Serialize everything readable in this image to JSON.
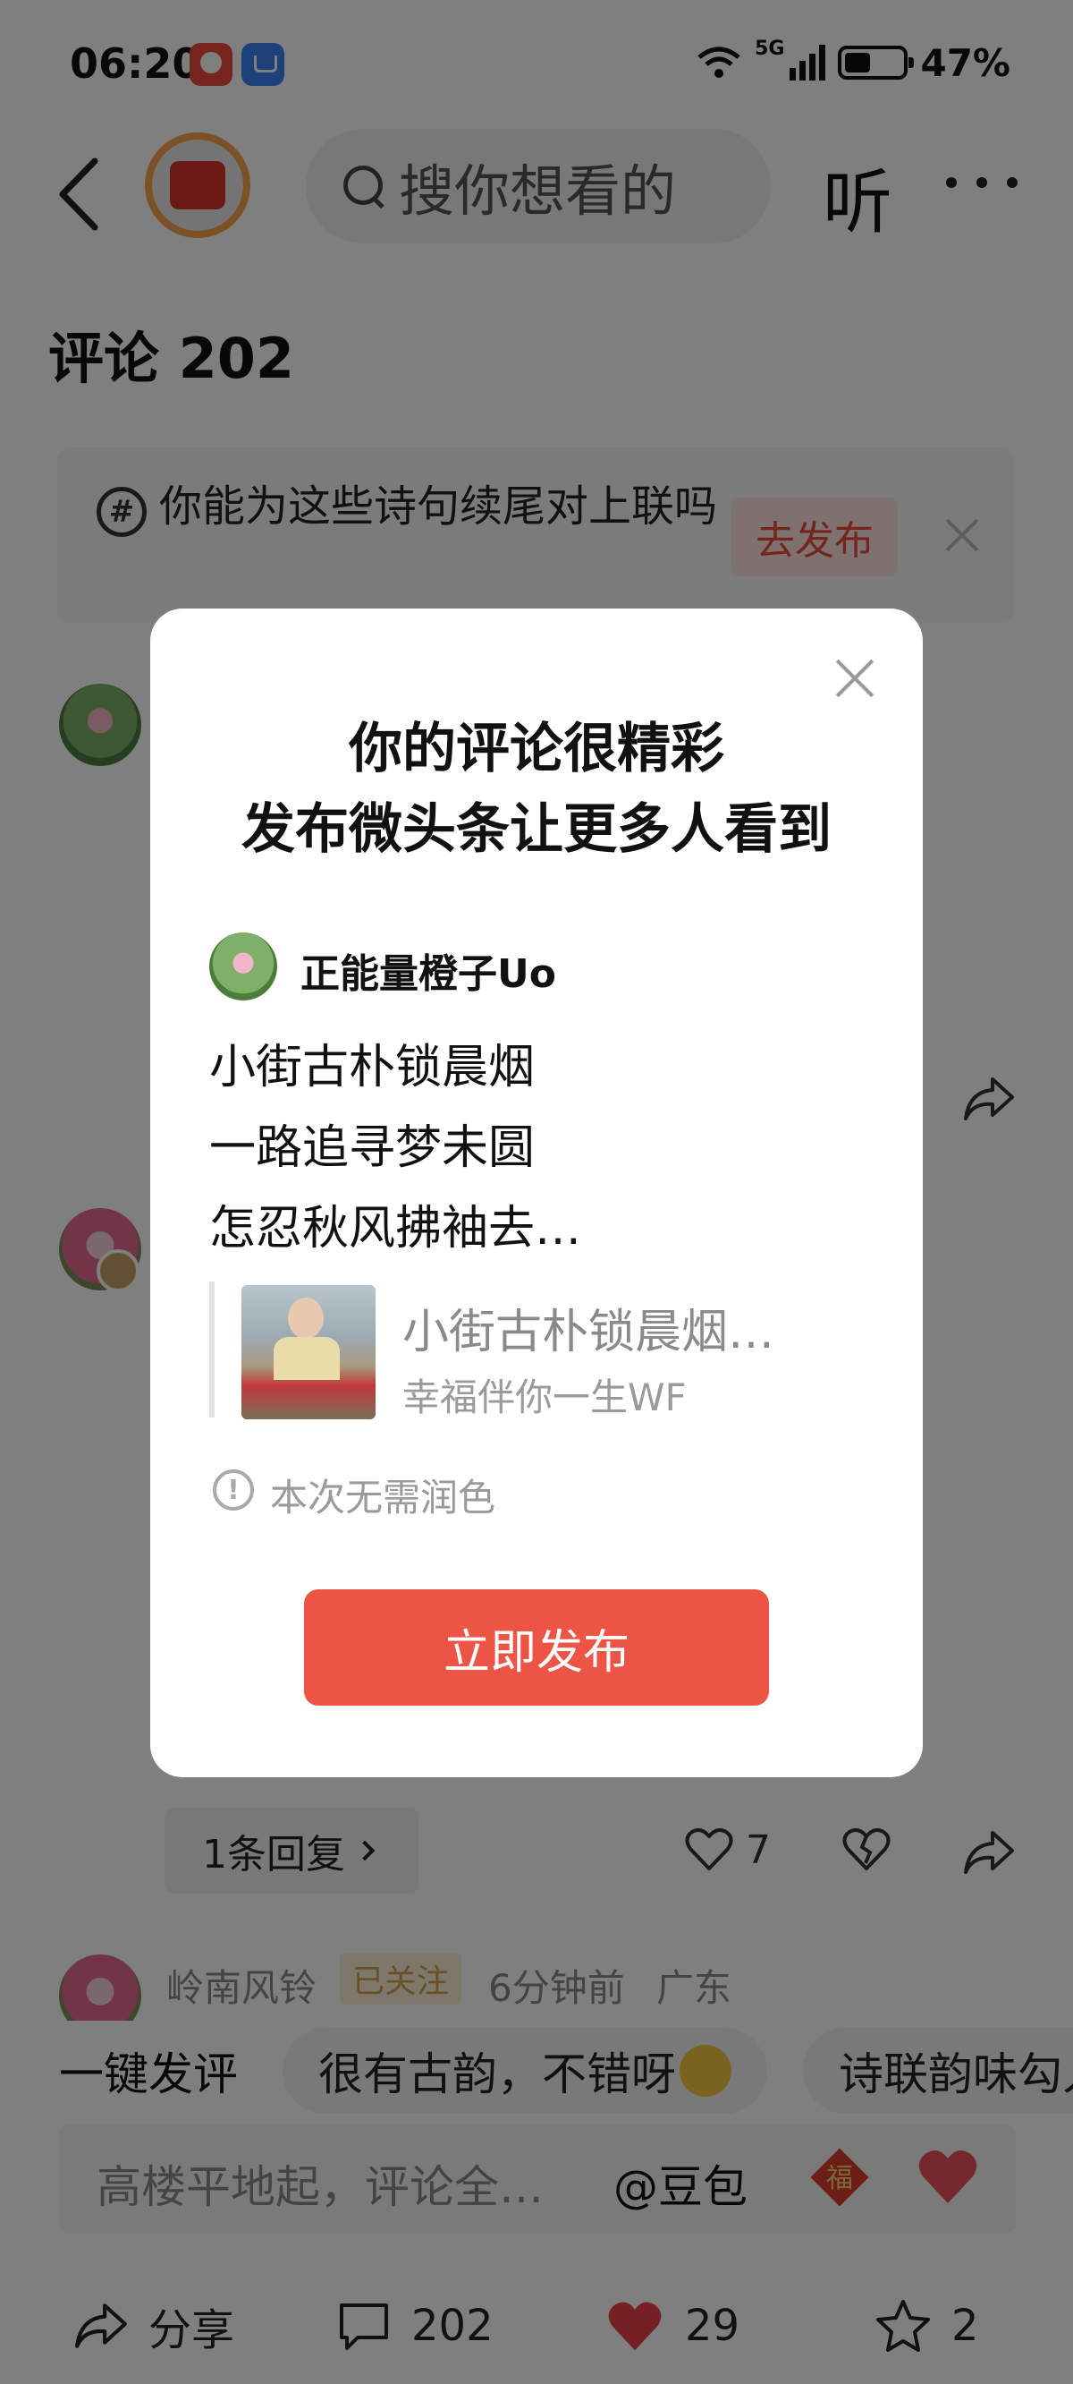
{
  "status_bar": {
    "time": "06:20",
    "network": "5G",
    "battery": "47%",
    "icons": [
      "wifi-icon",
      "signal-icon",
      "battery-icon"
    ]
  },
  "header": {
    "search_placeholder": "搜你想看的",
    "listen_label": "听",
    "icons": [
      "back-icon",
      "avatar",
      "search-icon",
      "more-icon"
    ]
  },
  "comments": {
    "title": "评论 202"
  },
  "topic_banner": {
    "text": "你能为这些诗句续尾对上联吗",
    "button": "去发布"
  },
  "comment_thread": {
    "reply_count": "1条回复",
    "like_count": "7"
  },
  "third_comment": {
    "name": "岭南风铃",
    "follow_status": "已关注",
    "time": "6分钟前",
    "location": "广东"
  },
  "quick_reply": {
    "label": "一键发评",
    "chips": [
      "很有古韵，不错呀",
      "诗联韵味勾人"
    ]
  },
  "input_bar": {
    "placeholder": "高楼平地起，评论全…",
    "mention": "@豆包"
  },
  "bottom_bar": {
    "share_label": "分享",
    "comment_count": "202",
    "like_count": "29",
    "favorite_count": "2"
  },
  "modal": {
    "title_line1": "你的评论很精彩",
    "title_line2": "发布微头条让更多人看到",
    "username": "正能量橙子Uo",
    "lines": [
      "小街古朴锁晨烟",
      "一路追寻梦未圆",
      "怎忍秋风拂袖去…"
    ],
    "quote_title": "小街古朴锁晨烟…",
    "quote_author": "幸福伴你一生WF",
    "notice": "本次无需润色",
    "publish_button": "立即发布"
  },
  "colors": {
    "accent_red": "#ec5446",
    "follow_gold": "#d4a04a",
    "overlay": "rgba(0,0,0,0.5)"
  }
}
